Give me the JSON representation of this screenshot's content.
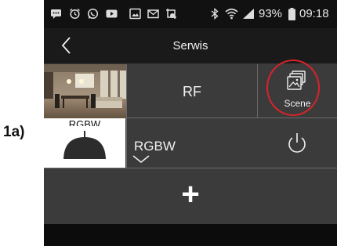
{
  "annotation": {
    "label": "1a)"
  },
  "status_bar": {
    "battery": "93%",
    "time": "09:18",
    "icons": [
      "message-icon",
      "alarm-icon",
      "whatsapp-icon",
      "video-icon",
      "gallery-icon",
      "mail-icon",
      "screenshot-icon",
      "bluetooth-icon",
      "wifi-icon",
      "signal-icon",
      "battery-icon"
    ]
  },
  "header": {
    "title": "Serwis"
  },
  "tiles": {
    "rf": {
      "label": "RF"
    },
    "scene": {
      "label": "Scene",
      "icon": "scene-gallery-icon"
    }
  },
  "device": {
    "tile_label": "RGBW",
    "name": "RGBW",
    "icon": "lamp-icon",
    "power_icon": "power-icon",
    "expand_icon": "chevron-down-icon"
  },
  "add_button": {
    "label": "+"
  },
  "colors": {
    "background": "#3b3b3b",
    "header": "#1a1a1a",
    "status_bar": "#111111",
    "highlight": "#d9232a"
  }
}
